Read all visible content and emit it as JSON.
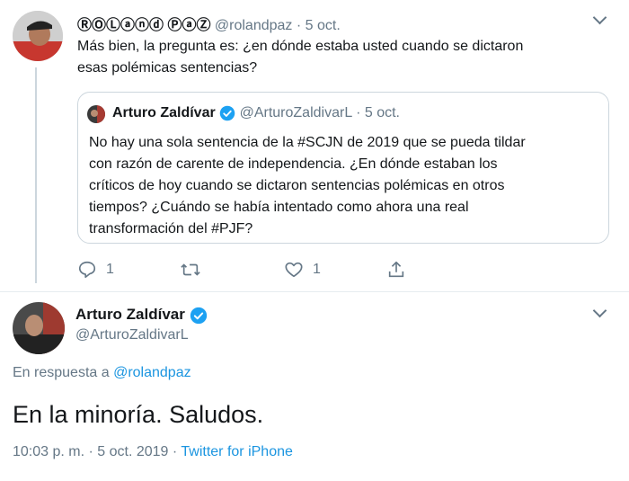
{
  "tweet1": {
    "display_name": "ⓇⓄⓁⓐⓝⓓ ⓅⓐⓏ",
    "handle": "@rolandpaz",
    "separator": "·",
    "date": "5 oct.",
    "text_line1": "Más bien, la pregunta es: ¿en dónde estaba usted cuando se dictaron",
    "text_line2": "esas polémicas sentencias?",
    "quoted": {
      "display_name": "Arturo Zaldívar",
      "handle": "@ArturoZaldivarL",
      "separator": "·",
      "date": "5 oct.",
      "lines": [
        "No hay una sola sentencia de la #SCJN de 2019 que se pueda tildar",
        "con razón de carente de independencia. ¿En dónde estaban los",
        "críticos de hoy cuando se dictaron sentencias polémicas en otros",
        "tiempos?  ¿Cuándo se había intentado como ahora una real",
        "transformación del #PJF?"
      ]
    },
    "actions": {
      "reply_count": "1",
      "retweet_count": "",
      "like_count": "1"
    }
  },
  "tweet2": {
    "display_name": "Arturo Zaldívar",
    "handle": "@ArturoZaldivarL",
    "reply_prefix": "En respuesta a",
    "reply_to": "@rolandpaz",
    "text": "En la minoría. Saludos.",
    "time": "10:03 p. m.",
    "separator": "·",
    "date": "5 oct. 2019",
    "source": "Twitter for iPhone"
  },
  "icons": [
    "chevron-down-icon",
    "verified-badge-icon",
    "reply-icon",
    "retweet-icon",
    "like-icon",
    "share-icon"
  ],
  "colors": {
    "link": "#1b95e0",
    "muted": "#657786",
    "verified": "#1da1f2",
    "border": "#ccd6dd"
  }
}
